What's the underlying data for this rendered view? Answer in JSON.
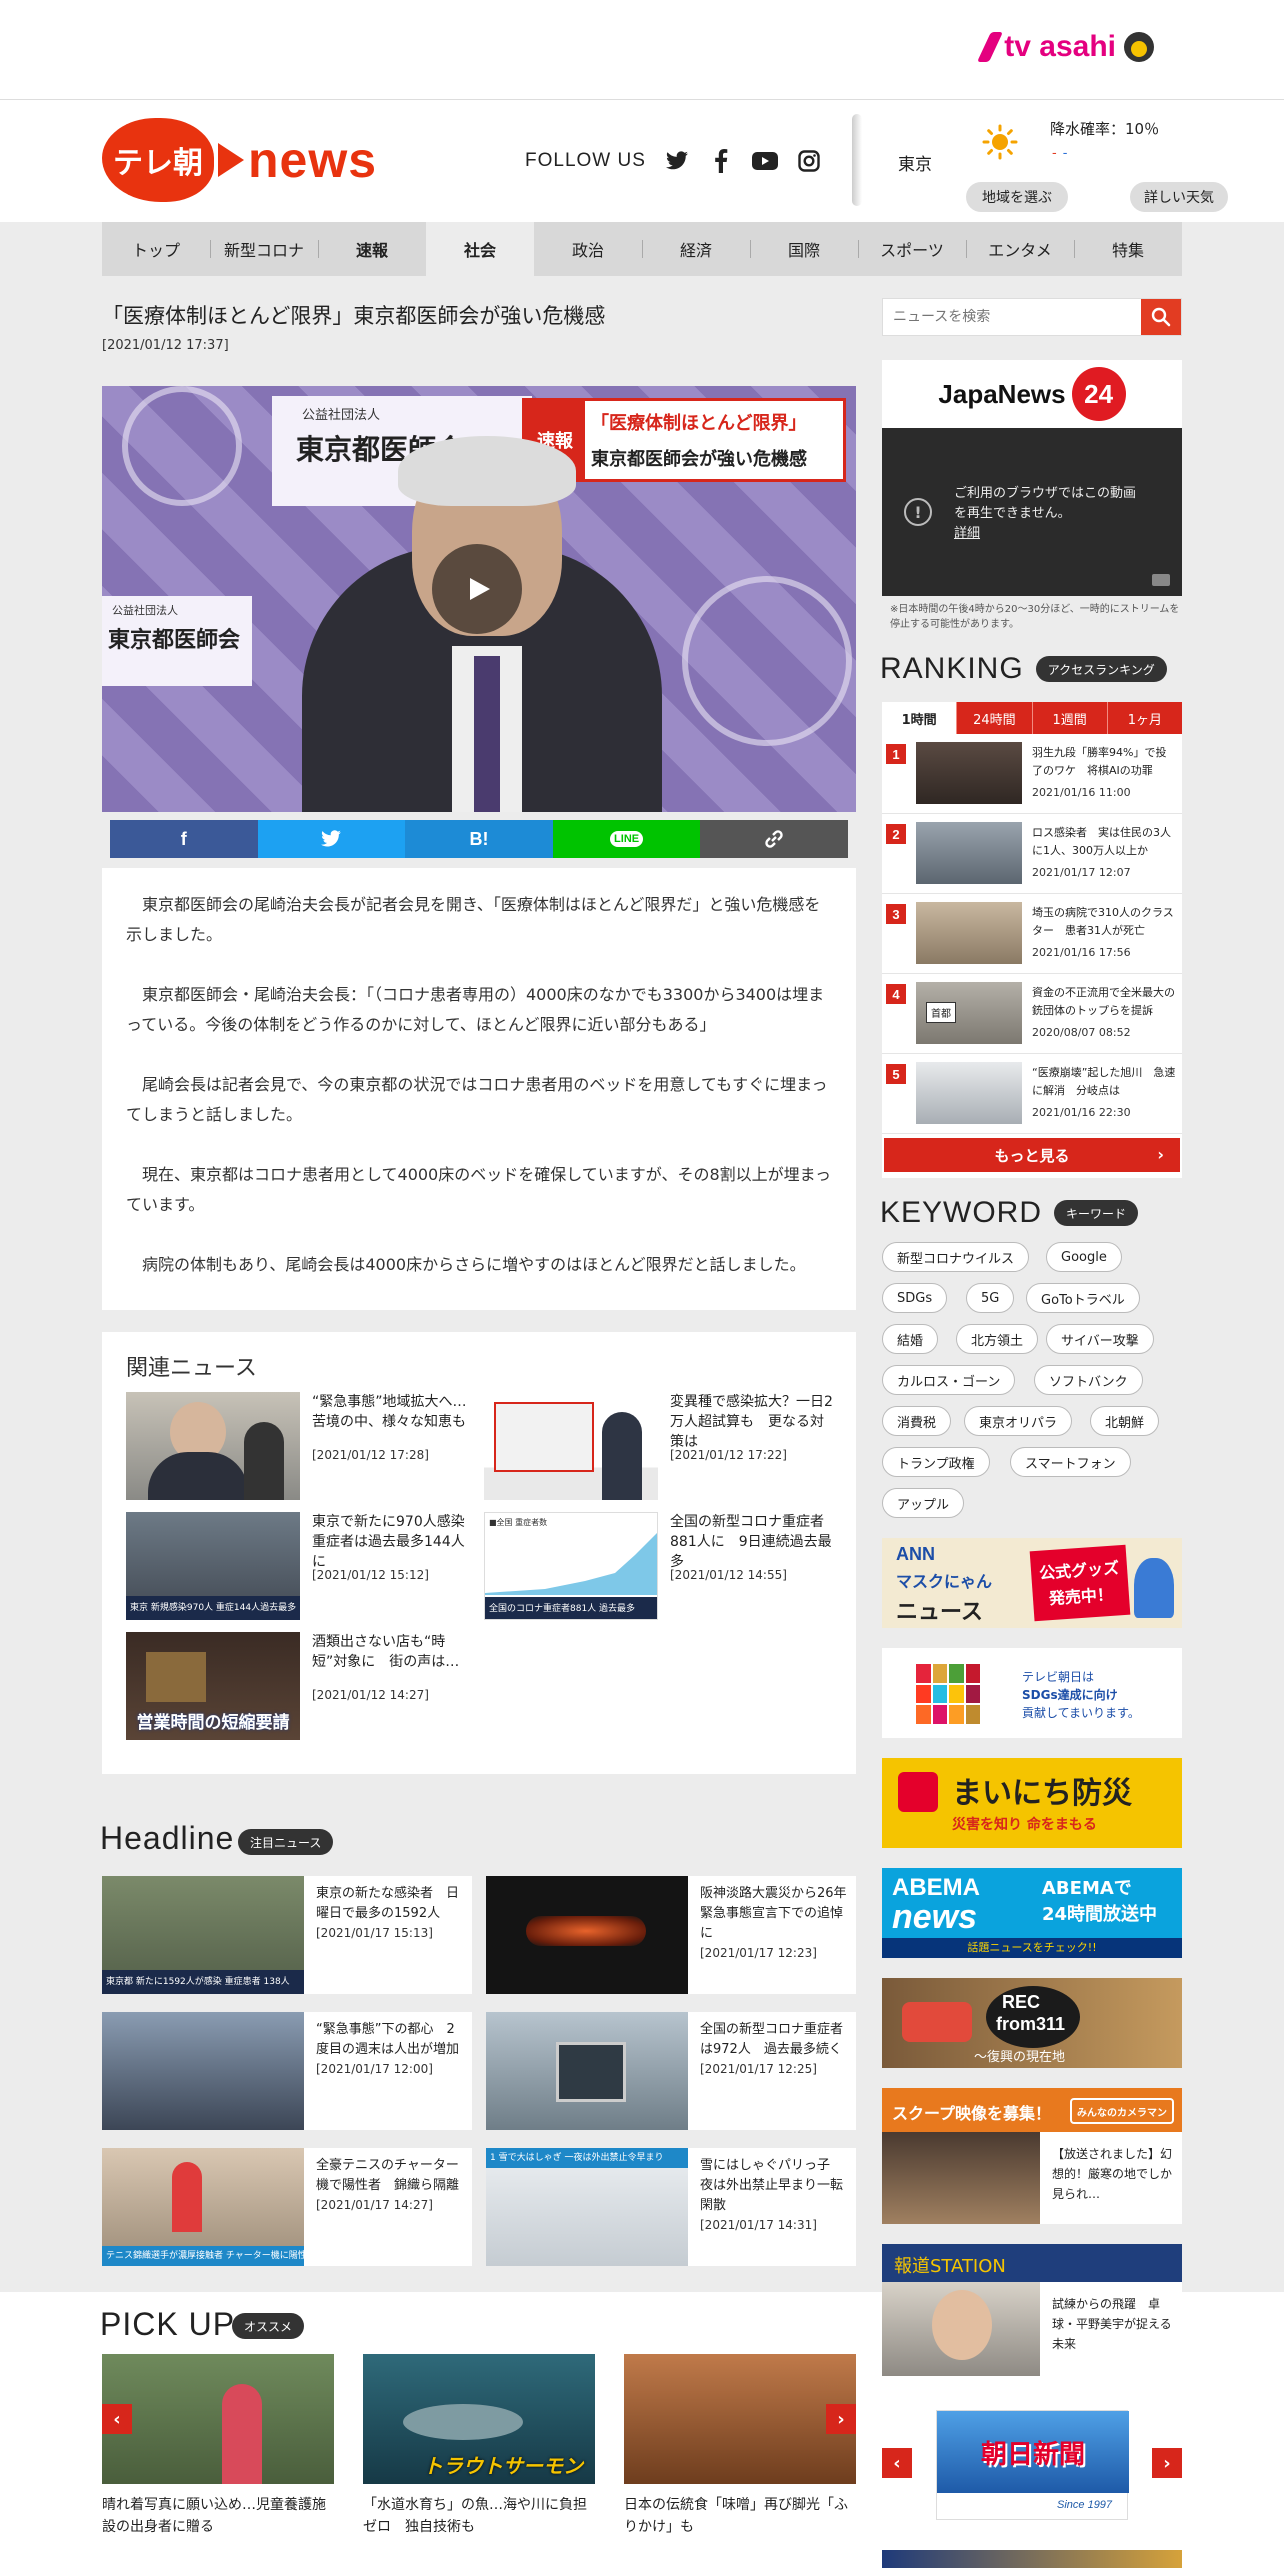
{
  "brand": {
    "tv_asahi": "tv asahi",
    "logo_main": "テレ朝",
    "logo_news": "news"
  },
  "follow": {
    "label": "FOLLOW US"
  },
  "weather": {
    "city": "東京",
    "rain": "降水確率：10％",
    "region_btn": "地域を選ぶ",
    "detail_btn": "詳しい天気"
  },
  "nav": [
    {
      "label": "トップ"
    },
    {
      "label": "新型コロナ"
    },
    {
      "label": "速報"
    },
    {
      "label": "社会"
    },
    {
      "label": "政治"
    },
    {
      "label": "経済"
    },
    {
      "label": "国際"
    },
    {
      "label": "スポーツ"
    },
    {
      "label": "エンタメ"
    },
    {
      "label": "特集"
    }
  ],
  "article": {
    "title": "「医療体制ほとんど限界」東京都医師会が強い危機感",
    "date": "[2021/01/12 17:37]",
    "video": {
      "banner_tag": "速報",
      "banner_line1": "「医療体制ほとんど限界」",
      "banner_line2": "東京都医師会が強い危機感",
      "sign_small": "公益社団法人",
      "sign_org": "東京都医師会",
      "sign_small2": "公益社団法人",
      "sign_org2": "東京都医師会"
    },
    "share": {
      "facebook": "f",
      "twitter": "t",
      "hatena": "B!",
      "line": "LINE",
      "link": "link"
    },
    "paragraphs": [
      "東京都医師会の尾崎治夫会長が記者会見を開き、「医療体制はほとんど限界だ」と強い危機感を示しました。",
      "東京都医師会・尾崎治夫会長：「（コロナ患者専用の）4000床のなかでも3300から3400は埋まっている。今後の体制をどう作るのかに対して、ほとんど限界に近い部分もある」",
      "尾崎会長は記者会見で、今の東京都の状況ではコロナ患者用のベッドを用意してもすぐに埋まってしまうと話しました。",
      "現在、東京都はコロナ患者用として4000床のベッドを確保していますが、その8割以上が埋まっています。",
      "病院の体制もあり、尾崎会長は4000床からさらに増やすのはほとんど限界だと話しました。"
    ]
  },
  "related": {
    "title": "関連ニュース",
    "items": [
      {
        "title": "“緊急事態”地域拡大へ…苦境の中、様々な知恵も",
        "date": "[2021/01/12 17:28]"
      },
      {
        "title": "変異種で感染拡大？一日2万人超試算も　更なる対策は",
        "date": "[2021/01/12 17:22]"
      },
      {
        "title": "東京で新たに970人感染　重症者は過去最多144人に",
        "date": "[2021/01/12 15:12]",
        "caption": "東京 新規感染970人 重症144人過去最多"
      },
      {
        "title": "全国の新型コロナ重症者881人に　9日連続過去最多",
        "date": "[2021/01/12 14:55]",
        "caption": "全国のコロナ重症者881人 過去最多",
        "chart_label": "■全国 重症者数"
      },
      {
        "title": "酒類出さない店も“時短”対象に　街の声は…",
        "date": "[2021/01/12 14:27]",
        "caption": "営業時間の短縮要請"
      }
    ]
  },
  "headline": {
    "title": "Headline",
    "badge": "注目ニュース",
    "items": [
      {
        "title": "東京の新たな感染者　日曜日で最多の1592人",
        "date": "[2021/01/17 15:13]",
        "caption": "東京都 新たに1592人が感染 重症患者 138人"
      },
      {
        "title": "阪神淡路大震災から26年　緊急事態宣言下での追悼に",
        "date": "[2021/01/17 12:23]"
      },
      {
        "title": "“緊急事態”下の都心　2度目の週末は人出が増加",
        "date": "[2021/01/17 12:00]"
      },
      {
        "title": "全国の新型コロナ重症者は972人　過去最多続く",
        "date": "[2021/01/17 12:25]"
      },
      {
        "title": "全豪テニスのチャーター機で陽性者　錦織ら隔離",
        "date": "[2021/01/17 14:27]",
        "caption": "テニス錦織選手が濃厚接触者 チャーター機に陽性者"
      },
      {
        "title": "雪にはしゃぐパリっ子　夜は外出禁止早まり一転閑散",
        "date": "[2021/01/17 14:31]",
        "caption": "1 雪で大はしゃぎ 一夜は外出禁止令早まり"
      }
    ]
  },
  "pickup": {
    "title": "PICK UP",
    "badge": "オススメ",
    "items": [
      {
        "title": "晴れ着写真に願い込め…児童養護施設の出身者に贈る"
      },
      {
        "title": "「水道水育ち」の魚…海や川に負担ゼロ　独自技術も",
        "overlay": "トラウトサーモン"
      },
      {
        "title": "日本の伝統食「味噌」再び脚光「ふりかけ」も"
      }
    ]
  },
  "sidebar": {
    "search_placeholder": "ニュースを検索",
    "jn24": {
      "name": "JapaNews",
      "num": "24",
      "msg1": "ご利用のブラウザではこの動画",
      "msg2": "を再生できません。",
      "link": "詳細"
    },
    "jn24_note": "※日本時間の午後4時から20～30分ほど、一時的にストリームを停止する可能性があります。",
    "ranking": {
      "title": "RANKING",
      "badge": "アクセスランキング",
      "tabs": [
        "1時間",
        "24時間",
        "1週間",
        "1ヶ月"
      ],
      "items": [
        {
          "rank": "1",
          "title": "羽生九段「勝率94%」で投了のワケ　将棋AIの功罪",
          "date": "2021/01/16 11:00"
        },
        {
          "rank": "2",
          "title": "ロス感染者　実は住民の3人に1人、300万人以上か",
          "date": "2021/01/17 12:07"
        },
        {
          "rank": "3",
          "title": "埼玉の病院で310人のクラスター　患者31人が死亡",
          "date": "2021/01/16 17:56"
        },
        {
          "rank": "4",
          "title": "資金の不正流用で全米最大の銃団体のトップらを提訴",
          "date": "2020/08/07 08:52",
          "sign": "首都"
        },
        {
          "rank": "5",
          "title": "“医療崩壊”起した旭川　急速に解消　分岐点は",
          "date": "2021/01/16 22:30"
        }
      ],
      "more": "もっと見る"
    },
    "keyword": {
      "title": "KEYWORD",
      "badge": "キーワード",
      "items": [
        "新型コロナウイルス",
        "Google",
        "SDGs",
        "5G",
        "GoToトラベル",
        "結婚",
        "北方領土",
        "サイバー攻撃",
        "カルロス・ゴーン",
        "ソフトバンク",
        "消費税",
        "東京オリパラ",
        "北朝鮮",
        "トランプ政権",
        "スマートフォン",
        "アップル"
      ]
    },
    "ads": {
      "ann_top": "ANN",
      "ann_mid": "マスクにゃん",
      "ann_bottom": "ニュース",
      "ann_badge1": "公式グッズ",
      "ann_badge2": "発売中！",
      "sdgs_line1": "テレビ朝日は",
      "sdgs_line2": "SDGs達成に向け",
      "sdgs_line3": "貢献してまいります。",
      "bousai_title": "まいにち防災",
      "bousai_sub": "災害を知り 命をまもる",
      "abema_name1": "ABEMA",
      "abema_name2": "news",
      "abema_text1": "ABEMAで",
      "abema_text2": "24時間放送中",
      "abema_sub": "話題ニュースをチェック!!",
      "rec_top": "REC",
      "rec_main": "from311",
      "rec_sub": "～復興の現在地",
      "scoop_title": "スクープ映像を募集！",
      "scoop_brand": "みんなのカメラマン",
      "scoop_text": "【放送されました】幻想的！厳寒の地でしか見られ…",
      "station_title": "報道STATION",
      "station_text": "試練からの飛躍　卓球・平野美宇が捉える未来",
      "sakae_title": "朝日新聞",
      "sakae_since": "Since 1997"
    },
    "colors": {
      "accent": "#d7261b",
      "logo": "#e8330f",
      "tvasahi": "#e4007f"
    }
  }
}
